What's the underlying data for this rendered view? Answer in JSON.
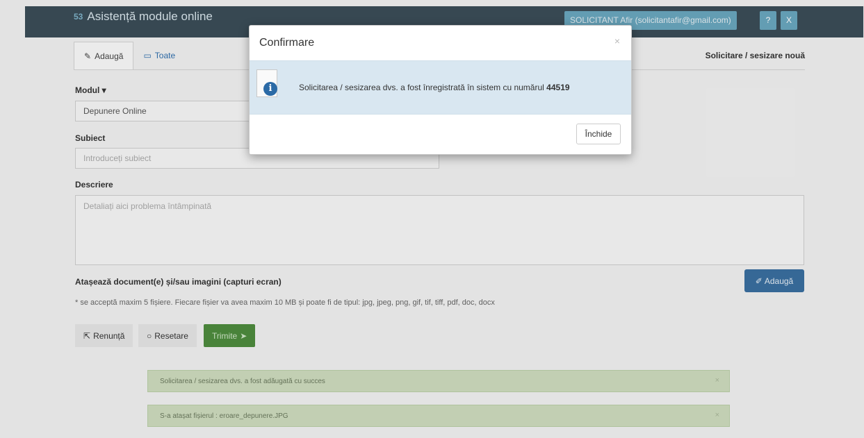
{
  "app": {
    "logo_text": "53",
    "title": "Asistență module online",
    "user_label": "SOLICITANT Afir (solicitantafir@gmail.com)",
    "help_label": "?",
    "close_label": "X"
  },
  "tabs": [
    {
      "label": "Adaugă",
      "icon": "edit-icon"
    },
    {
      "label": "Toate",
      "icon": "inbox-icon"
    }
  ],
  "page_heading": "Solicitare / sesizare nouă",
  "form": {
    "module_label": "Modul",
    "module_value": "Depunere Online",
    "subject_label": "Subiect",
    "subject_placeholder": "Introduceți subiect",
    "description_label": "Descriere",
    "description_placeholder": "Detaliați aici problema întâmpinată",
    "attach_label": "Atașează document(e) și/sau imagini (capturi ecran)",
    "attach_button": "Adaugă",
    "note": "* se acceptă maxim 5 fișiere. Fiecare fișier va avea maxim 10 MB și poate fi de tipul: jpg, jpeg, png, gif, tif, tiff, pdf, doc, docx"
  },
  "actions": {
    "cancel": "Renunță",
    "reset": "Resetare",
    "send": "Trimite"
  },
  "alerts": [
    {
      "text": "Solicitarea / sesizarea dvs. a fost adăugată cu succes",
      "close": "×"
    },
    {
      "text": "S-a atașat fișierul : eroare_depunere.JPG",
      "close": "×"
    }
  ],
  "modal": {
    "title": "Confirmare",
    "close_symbol": "×",
    "message": "Solicitarea / sesizarea dvs. a fost înregistrată în sistem cu numărul",
    "number": "44519",
    "button": "Închide"
  },
  "colors": {
    "topbar": "#3b4d58",
    "accent": "#6aa7bf",
    "primary": "#3a6fa0",
    "success": "#4e8c3e",
    "modal_body": "#d9e7f1"
  }
}
